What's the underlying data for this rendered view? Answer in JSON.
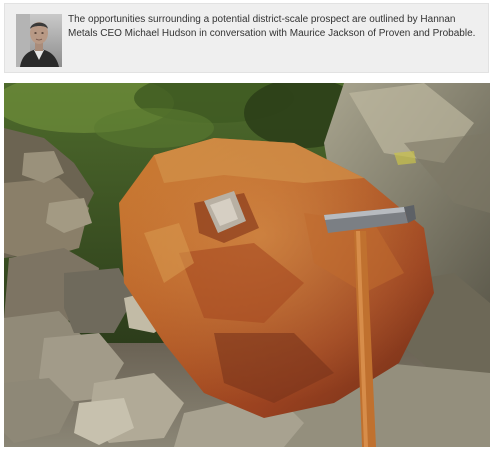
{
  "article": {
    "intro_text": "The opportunities surrounding a potential district-scale prospect are outlined by Hannan Metals CEO Michael Hudson in conversation with Maurice Jackson of Proven and Probable."
  },
  "avatar": {
    "icon": "person-portrait"
  },
  "photo": {
    "subject": "rock-outcrop-with-hammer"
  },
  "colors": {
    "intro_background": "#efefef",
    "text": "#333333",
    "boulder_rust": "#b25a22"
  }
}
